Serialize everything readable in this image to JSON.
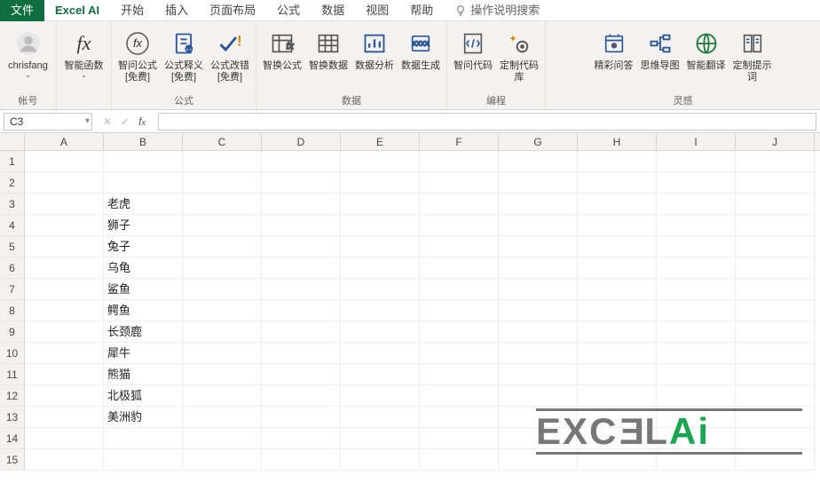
{
  "tabs": {
    "file": "文件",
    "excel_ai": "Excel AI",
    "home": "开始",
    "insert": "插入",
    "layout": "页面布局",
    "formula": "公式",
    "data": "数据",
    "view": "视图",
    "help": "帮助",
    "search_placeholder": "操作说明搜索"
  },
  "ribbon": {
    "account": {
      "user": "chrisfang",
      "label": "帐号"
    },
    "smart_fn": {
      "btn": "智能函数",
      "label": ""
    },
    "formula_group": {
      "q_formula": "智问公式\n[免费]",
      "interpret": "公式释义\n[免费]",
      "fix": "公式改错\n[免费]",
      "label": "公式"
    },
    "data_group": {
      "swap_formula": "智换公式",
      "swap_data": "智换数据",
      "analyze": "数据分析",
      "generate": "数据生成",
      "label": "数据"
    },
    "code_group": {
      "q_code": "智问代码",
      "custom_repo": "定制代码库",
      "label": "编程"
    },
    "insight_group": {
      "qa": "精彩问答",
      "mindmap": "思维导图",
      "translate": "智能翻译",
      "prompt": "定制提示词",
      "label": "灵感"
    }
  },
  "formula_bar": {
    "cell_ref": "C3",
    "value": ""
  },
  "columns": [
    "A",
    "B",
    "C",
    "D",
    "E",
    "F",
    "G",
    "H",
    "I",
    "J"
  ],
  "rows": [
    1,
    2,
    3,
    4,
    5,
    6,
    7,
    8,
    9,
    10,
    11,
    12,
    13,
    14,
    15
  ],
  "cell_data": {
    "B3": "老虎",
    "B4": "狮子",
    "B5": "兔子",
    "B6": "乌龟",
    "B7": "鲨鱼",
    "B8": "鳄鱼",
    "B9": "长颈鹿",
    "B10": "犀牛",
    "B11": "熊猫",
    "B12": "北极狐",
    "B13": "美洲豹"
  },
  "watermark": {
    "text_part1": "EXC",
    "text_e3": "E",
    "text_part2": "L",
    "text_ai": "Ai"
  }
}
